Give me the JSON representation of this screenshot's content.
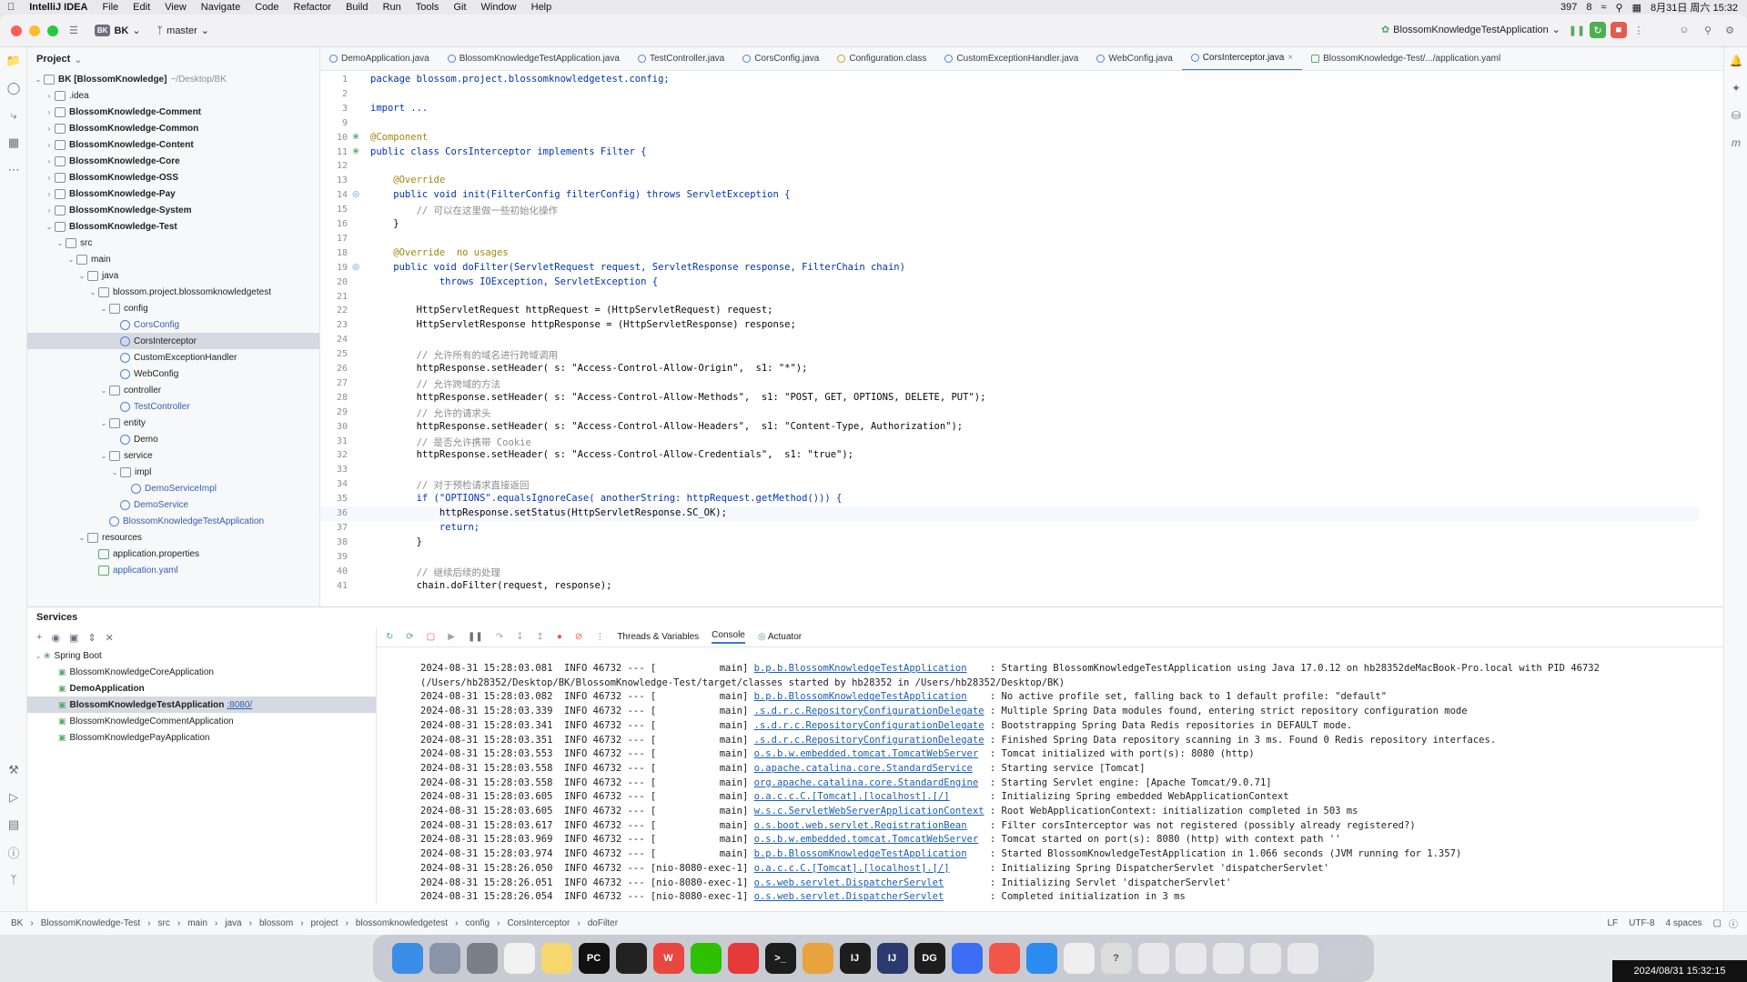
{
  "menubar": {
    "app": "IntelliJ IDEA",
    "items": [
      "File",
      "Edit",
      "View",
      "Navigate",
      "Code",
      "Refactor",
      "Build",
      "Run",
      "Tools",
      "Git",
      "Window",
      "Help"
    ],
    "status_count_1": "397",
    "status_count_2": "8",
    "datetime": "8月31日 周六 15:32"
  },
  "titlebar": {
    "project_badge": "BK",
    "project": "BK",
    "branch": "master",
    "run_config": "BlossomKnowledgeTestApplication"
  },
  "project_panel": {
    "title": "Project",
    "tree": [
      {
        "label": "BK [BlossomKnowledge]",
        "suffix": "~/Desktop/BK",
        "indent": 0,
        "arrow": "open",
        "type": "folder",
        "bold": true
      },
      {
        "label": ".idea",
        "indent": 1,
        "arrow": "closed",
        "type": "folder"
      },
      {
        "label": "BlossomKnowledge-Comment",
        "indent": 1,
        "arrow": "closed",
        "type": "folder",
        "bold": true
      },
      {
        "label": "BlossomKnowledge-Common",
        "indent": 1,
        "arrow": "closed",
        "type": "folder",
        "bold": true
      },
      {
        "label": "BlossomKnowledge-Content",
        "indent": 1,
        "arrow": "closed",
        "type": "folder",
        "bold": true
      },
      {
        "label": "BlossomKnowledge-Core",
        "indent": 1,
        "arrow": "closed",
        "type": "folder",
        "bold": true
      },
      {
        "label": "BlossomKnowledge-OSS",
        "indent": 1,
        "arrow": "closed",
        "type": "folder",
        "bold": true
      },
      {
        "label": "BlossomKnowledge-Pay",
        "indent": 1,
        "arrow": "closed",
        "type": "folder",
        "bold": true
      },
      {
        "label": "BlossomKnowledge-System",
        "indent": 1,
        "arrow": "closed",
        "type": "folder",
        "bold": true
      },
      {
        "label": "BlossomKnowledge-Test",
        "indent": 1,
        "arrow": "open",
        "type": "folder",
        "bold": true
      },
      {
        "label": "src",
        "indent": 2,
        "arrow": "open",
        "type": "folder"
      },
      {
        "label": "main",
        "indent": 3,
        "arrow": "open",
        "type": "folder"
      },
      {
        "label": "java",
        "indent": 4,
        "arrow": "open",
        "type": "folder"
      },
      {
        "label": "blossom.project.blossomknowledgetest",
        "indent": 5,
        "arrow": "open",
        "type": "folder"
      },
      {
        "label": "config",
        "indent": 6,
        "arrow": "open",
        "type": "folder"
      },
      {
        "label": "CorsConfig",
        "indent": 7,
        "arrow": "none",
        "type": "class",
        "blue": true
      },
      {
        "label": "CorsInterceptor",
        "indent": 7,
        "arrow": "none",
        "type": "class",
        "selected": true
      },
      {
        "label": "CustomExceptionHandler",
        "indent": 7,
        "arrow": "none",
        "type": "class"
      },
      {
        "label": "WebConfig",
        "indent": 7,
        "arrow": "none",
        "type": "class"
      },
      {
        "label": "controller",
        "indent": 6,
        "arrow": "open",
        "type": "folder"
      },
      {
        "label": "TestController",
        "indent": 7,
        "arrow": "none",
        "type": "class",
        "blue": true
      },
      {
        "label": "entity",
        "indent": 6,
        "arrow": "open",
        "type": "folder"
      },
      {
        "label": "Demo",
        "indent": 7,
        "arrow": "none",
        "type": "class"
      },
      {
        "label": "service",
        "indent": 6,
        "arrow": "open",
        "type": "folder"
      },
      {
        "label": "impl",
        "indent": 7,
        "arrow": "open",
        "type": "folder"
      },
      {
        "label": "DemoServiceImpl",
        "indent": 8,
        "arrow": "none",
        "type": "class",
        "blue": true
      },
      {
        "label": "DemoService",
        "indent": 7,
        "arrow": "none",
        "type": "class",
        "blue": true
      },
      {
        "label": "BlossomKnowledgeTestApplication",
        "indent": 6,
        "arrow": "none",
        "type": "class",
        "blue": true
      },
      {
        "label": "resources",
        "indent": 4,
        "arrow": "open",
        "type": "folder"
      },
      {
        "label": "application.properties",
        "indent": 5,
        "arrow": "none",
        "type": "file"
      },
      {
        "label": "application.yaml",
        "indent": 5,
        "arrow": "none",
        "type": "file",
        "blue": true
      }
    ]
  },
  "tabs": [
    {
      "label": "DemoApplication.java"
    },
    {
      "label": "BlossomKnowledgeTestApplication.java"
    },
    {
      "label": "TestController.java"
    },
    {
      "label": "CorsConfig.java"
    },
    {
      "label": "Configuration.class"
    },
    {
      "label": "CustomExceptionHandler.java"
    },
    {
      "label": "WebConfig.java"
    },
    {
      "label": "CorsInterceptor.java",
      "active": true
    },
    {
      "label": "BlossomKnowledge-Test/.../application.yaml"
    }
  ],
  "editor": {
    "lines": [
      {
        "n": "1",
        "t": "package blossom.project.blossomknowledgetest.config;"
      },
      {
        "n": "2",
        "t": ""
      },
      {
        "n": "3",
        "t": "import ..."
      },
      {
        "n": "9",
        "t": ""
      },
      {
        "n": "10",
        "t": "@Component",
        "g": "bean"
      },
      {
        "n": "11",
        "t": "public class CorsInterceptor implements Filter {",
        "g": "bean"
      },
      {
        "n": "12",
        "t": ""
      },
      {
        "n": "13",
        "t": "    @Override"
      },
      {
        "n": "14",
        "t": "    public void init(FilterConfig filterConfig) throws ServletException {",
        "g": "impl"
      },
      {
        "n": "15",
        "t": "        // 可以在这里做一些初始化操作"
      },
      {
        "n": "16",
        "t": "    }"
      },
      {
        "n": "17",
        "t": ""
      },
      {
        "n": "18",
        "t": "    @Override  no usages"
      },
      {
        "n": "19",
        "t": "    public void doFilter(ServletRequest request, ServletResponse response, FilterChain chain)",
        "g": "impl"
      },
      {
        "n": "20",
        "t": "            throws IOException, ServletException {"
      },
      {
        "n": "21",
        "t": ""
      },
      {
        "n": "22",
        "t": "        HttpServletRequest httpRequest = (HttpServletRequest) request;"
      },
      {
        "n": "23",
        "t": "        HttpServletResponse httpResponse = (HttpServletResponse) response;"
      },
      {
        "n": "24",
        "t": ""
      },
      {
        "n": "25",
        "t": "        // 允许所有的域名进行跨域调用"
      },
      {
        "n": "26",
        "t": "        httpResponse.setHeader( s: \"Access-Control-Allow-Origin\",  s1: \"*\");"
      },
      {
        "n": "27",
        "t": "        // 允许跨域的方法"
      },
      {
        "n": "28",
        "t": "        httpResponse.setHeader( s: \"Access-Control-Allow-Methods\",  s1: \"POST, GET, OPTIONS, DELETE, PUT\");"
      },
      {
        "n": "29",
        "t": "        // 允许的请求头"
      },
      {
        "n": "30",
        "t": "        httpResponse.setHeader( s: \"Access-Control-Allow-Headers\",  s1: \"Content-Type, Authorization\");"
      },
      {
        "n": "31",
        "t": "        // 是否允许携带 Cookie"
      },
      {
        "n": "32",
        "t": "        httpResponse.setHeader( s: \"Access-Control-Allow-Credentials\",  s1: \"true\");"
      },
      {
        "n": "33",
        "t": ""
      },
      {
        "n": "34",
        "t": "        // 对于预检请求直接返回"
      },
      {
        "n": "35",
        "t": "        if (\"OPTIONS\".equalsIgnoreCase( anotherString: httpRequest.getMethod())) {"
      },
      {
        "n": "36",
        "t": "            httpResponse.setStatus(HttpServletResponse.SC_OK);",
        "current": true
      },
      {
        "n": "37",
        "t": "            return;"
      },
      {
        "n": "38",
        "t": "        }"
      },
      {
        "n": "39",
        "t": ""
      },
      {
        "n": "40",
        "t": "        // 继续后续的处理"
      },
      {
        "n": "41",
        "t": "        chain.doFilter(request, response);"
      }
    ]
  },
  "services": {
    "title": "Services",
    "tree": [
      {
        "label": "Spring Boot",
        "indent": 0,
        "arrow": "open"
      },
      {
        "label": "BlossomKnowledgeCoreApplication",
        "indent": 1
      },
      {
        "label": "DemoApplication",
        "indent": 1,
        "bold": true
      },
      {
        "label": "BlossomKnowledgeTestApplication",
        "port": ":8080/",
        "indent": 1,
        "bold": true,
        "selected": true
      },
      {
        "label": "BlossomKnowledgeCommentApplication",
        "indent": 1
      },
      {
        "label": "BlossomKnowledgePayApplication",
        "indent": 1
      }
    ],
    "console_tabs": [
      "Threads & Variables",
      "Console",
      "Actuator"
    ],
    "log": [
      {
        "pre": "2024-08-31 15:28:03.081  INFO 46732 --- [           main] ",
        "cls": "b.p.b.BlossomKnowledgeTestApplication",
        "msg": "    : Starting BlossomKnowledgeTestApplication using Java 17.0.12 on hb28352deMacBook-Pro.local with PID 46732"
      },
      {
        "pre": "(/Users/hb28352/Desktop/BK/BlossomKnowledge-Test/target/classes started by hb28352 in /Users/hb28352/Desktop/BK)",
        "cls": "",
        "msg": ""
      },
      {
        "pre": "2024-08-31 15:28:03.082  INFO 46732 --- [           main] ",
        "cls": "b.p.b.BlossomKnowledgeTestApplication",
        "msg": "    : No active profile set, falling back to 1 default profile: \"default\""
      },
      {
        "pre": "2024-08-31 15:28:03.339  INFO 46732 --- [           main] ",
        "cls": ".s.d.r.c.RepositoryConfigurationDelegate",
        "msg": " : Multiple Spring Data modules found, entering strict repository configuration mode"
      },
      {
        "pre": "2024-08-31 15:28:03.341  INFO 46732 --- [           main] ",
        "cls": ".s.d.r.c.RepositoryConfigurationDelegate",
        "msg": " : Bootstrapping Spring Data Redis repositories in DEFAULT mode."
      },
      {
        "pre": "2024-08-31 15:28:03.351  INFO 46732 --- [           main] ",
        "cls": ".s.d.r.c.RepositoryConfigurationDelegate",
        "msg": " : Finished Spring Data repository scanning in 3 ms. Found 0 Redis repository interfaces."
      },
      {
        "pre": "2024-08-31 15:28:03.553  INFO 46732 --- [           main] ",
        "cls": "o.s.b.w.embedded.tomcat.TomcatWebServer",
        "msg": "  : Tomcat initialized with port(s): 8080 (http)"
      },
      {
        "pre": "2024-08-31 15:28:03.558  INFO 46732 --- [           main] ",
        "cls": "o.apache.catalina.core.StandardService",
        "msg": "   : Starting service [Tomcat]"
      },
      {
        "pre": "2024-08-31 15:28:03.558  INFO 46732 --- [           main] ",
        "cls": "org.apache.catalina.core.StandardEngine",
        "msg": "  : Starting Servlet engine: [Apache Tomcat/9.0.71]"
      },
      {
        "pre": "2024-08-31 15:28:03.605  INFO 46732 --- [           main] ",
        "cls": "o.a.c.c.C.[Tomcat].[localhost].[/]",
        "msg": "       : Initializing Spring embedded WebApplicationContext"
      },
      {
        "pre": "2024-08-31 15:28:03.605  INFO 46732 --- [           main] ",
        "cls": "w.s.c.ServletWebServerApplicationContext",
        "msg": " : Root WebApplicationContext: initialization completed in 503 ms"
      },
      {
        "pre": "2024-08-31 15:28:03.617  INFO 46732 --- [           main] ",
        "cls": "o.s.boot.web.servlet.RegistrationBean",
        "msg": "    : Filter corsInterceptor was not registered (possibly already registered?)"
      },
      {
        "pre": "2024-08-31 15:28:03.969  INFO 46732 --- [           main] ",
        "cls": "o.s.b.w.embedded.tomcat.TomcatWebServer",
        "msg": "  : Tomcat started on port(s): 8080 (http) with context path ''"
      },
      {
        "pre": "2024-08-31 15:28:03.974  INFO 46732 --- [           main] ",
        "cls": "b.p.b.BlossomKnowledgeTestApplication",
        "msg": "    : Started BlossomKnowledgeTestApplication in 1.066 seconds (JVM running for 1.357)"
      },
      {
        "pre": "2024-08-31 15:28:26.050  INFO 46732 --- [nio-8080-exec-1] ",
        "cls": "o.a.c.c.C.[Tomcat].[localhost].[/]",
        "msg": "       : Initializing Spring DispatcherServlet 'dispatcherServlet'"
      },
      {
        "pre": "2024-08-31 15:28:26.051  INFO 46732 --- [nio-8080-exec-1] ",
        "cls": "o.s.web.servlet.DispatcherServlet",
        "msg": "        : Initializing Servlet 'dispatcherServlet'"
      },
      {
        "pre": "2024-08-31 15:28:26.054  INFO 46732 --- [nio-8080-exec-1] ",
        "cls": "o.s.web.servlet.DispatcherServlet",
        "msg": "        : Completed initialization in 3 ms"
      }
    ]
  },
  "statusbar": {
    "crumbs": [
      "BK",
      "BlossomKnowledge-Test",
      "src",
      "main",
      "java",
      "blossom",
      "project",
      "blossomknowledgetest",
      "config",
      "CorsInterceptor",
      "doFilter"
    ],
    "line_sep": "LF",
    "encoding": "UTF-8",
    "indent": "4 spaces"
  },
  "dock": [
    {
      "name": "finder",
      "color": "#3b8ee8",
      "label": ""
    },
    {
      "name": "launchpad",
      "color": "#8a94a8",
      "label": ""
    },
    {
      "name": "system-settings",
      "color": "#7b7f88",
      "label": ""
    },
    {
      "name": "reminders",
      "color": "#f2f2f2",
      "label": ""
    },
    {
      "name": "notes",
      "color": "#f5d76e",
      "label": ""
    },
    {
      "name": "pycharm",
      "color": "#111111",
      "label": "PC"
    },
    {
      "name": "qq",
      "color": "#222222",
      "label": ""
    },
    {
      "name": "wps",
      "color": "#e9473f",
      "label": "W"
    },
    {
      "name": "wechat",
      "color": "#2dc100",
      "label": ""
    },
    {
      "name": "netease-music",
      "color": "#e63a3a",
      "label": ""
    },
    {
      "name": "terminal",
      "color": "#1d1d1d",
      "label": ">_"
    },
    {
      "name": "chrome",
      "color": "#e8a33c",
      "label": ""
    },
    {
      "name": "intellij",
      "color": "#1d1d1d",
      "label": "IJ"
    },
    {
      "name": "intellij-2",
      "color": "#2b3a6e",
      "label": "IJ"
    },
    {
      "name": "datagrip",
      "color": "#1d1d1d",
      "label": "DG"
    },
    {
      "name": "feishu",
      "color": "#3b6df5",
      "label": ""
    },
    {
      "name": "app-red",
      "color": "#f2564a",
      "label": ""
    },
    {
      "name": "app-blue",
      "color": "#2b8cf0",
      "label": ""
    },
    {
      "name": "document",
      "color": "#efefef",
      "label": ""
    },
    {
      "name": "help",
      "color": "#dcdcdc",
      "label": "?"
    },
    {
      "name": "window-1",
      "color": "#e8e8ea",
      "label": ""
    },
    {
      "name": "window-2",
      "color": "#e8e8ea",
      "label": ""
    },
    {
      "name": "window-3",
      "color": "#e8e8ea",
      "label": ""
    },
    {
      "name": "window-4",
      "color": "#e8e8ea",
      "label": ""
    },
    {
      "name": "window-5",
      "color": "#e8e8ea",
      "label": ""
    },
    {
      "name": "trash",
      "color": "#c9ccd2",
      "label": ""
    }
  ],
  "clock": "2024/08/31 15:32:15"
}
